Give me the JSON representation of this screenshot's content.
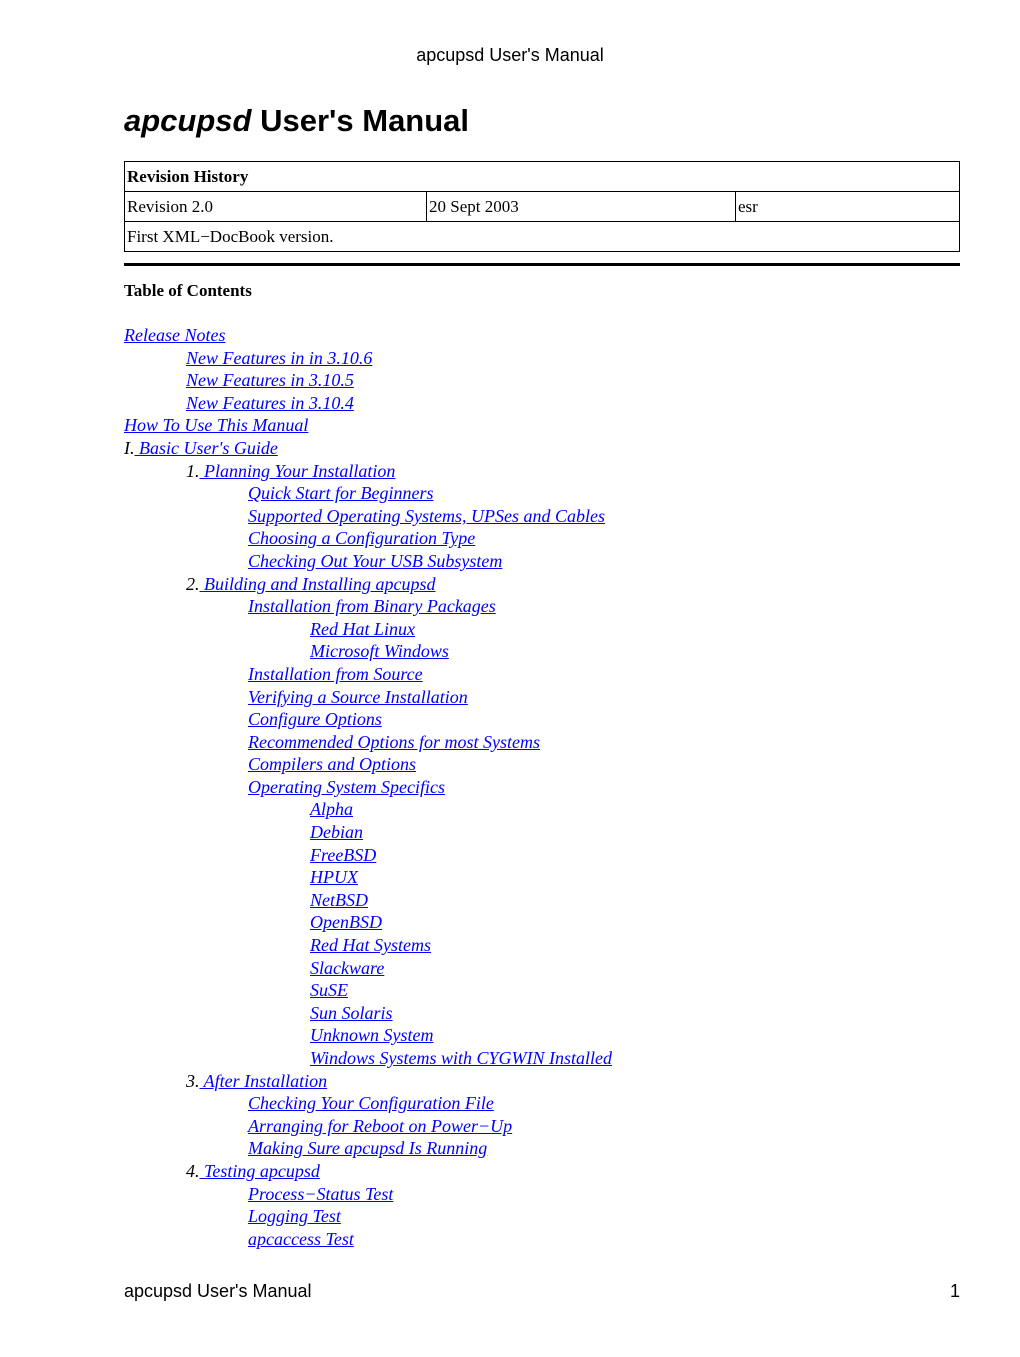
{
  "header": {
    "running_title": "apcupsd User's Manual"
  },
  "title": {
    "program": "apcupsd",
    "rest": " User's Manual"
  },
  "revision_history": {
    "heading": "Revision History",
    "revision": "Revision 2.0",
    "date": "20 Sept 2003",
    "author": "esr",
    "remark": "First XML−DocBook version."
  },
  "toc": {
    "heading": "Table of Contents",
    "entries": [
      {
        "level": 0,
        "prefix": "",
        "label": "Release Notes"
      },
      {
        "level": 1,
        "prefix": "",
        "label": "New Features in in 3.10.6"
      },
      {
        "level": 1,
        "prefix": "",
        "label": "New Features in 3.10.5"
      },
      {
        "level": 1,
        "prefix": "",
        "label": "New Features in 3.10.4"
      },
      {
        "level": 0,
        "prefix": "",
        "label": "How To Use This Manual"
      },
      {
        "level": 0,
        "prefix": "I.",
        "label": " Basic User's Guide"
      },
      {
        "level": 1,
        "prefix": "1.",
        "label": " Planning Your Installation"
      },
      {
        "level": 2,
        "prefix": "",
        "label": "Quick Start for Beginners"
      },
      {
        "level": 2,
        "prefix": "",
        "label": "Supported Operating Systems, UPSes and Cables"
      },
      {
        "level": 2,
        "prefix": "",
        "label": "Choosing a Configuration Type"
      },
      {
        "level": 2,
        "prefix": "",
        "label": "Checking Out Your USB Subsystem"
      },
      {
        "level": 1,
        "prefix": "2.",
        "label": " Building and Installing apcupsd"
      },
      {
        "level": 2,
        "prefix": "",
        "label": "Installation from Binary Packages"
      },
      {
        "level": 3,
        "prefix": "",
        "label": "Red Hat Linux"
      },
      {
        "level": 3,
        "prefix": "",
        "label": "Microsoft Windows"
      },
      {
        "level": 2,
        "prefix": "",
        "label": "Installation from Source"
      },
      {
        "level": 2,
        "prefix": "",
        "label": "Verifying a Source Installation"
      },
      {
        "level": 2,
        "prefix": "",
        "label": "Configure Options"
      },
      {
        "level": 2,
        "prefix": "",
        "label": "Recommended Options for most Systems"
      },
      {
        "level": 2,
        "prefix": "",
        "label": "Compilers and Options"
      },
      {
        "level": 2,
        "prefix": "",
        "label": "Operating System Specifics"
      },
      {
        "level": 3,
        "prefix": "",
        "label": "Alpha"
      },
      {
        "level": 3,
        "prefix": "",
        "label": "Debian"
      },
      {
        "level": 3,
        "prefix": "",
        "label": "FreeBSD"
      },
      {
        "level": 3,
        "prefix": "",
        "label": "HPUX"
      },
      {
        "level": 3,
        "prefix": "",
        "label": "NetBSD"
      },
      {
        "level": 3,
        "prefix": "",
        "label": "OpenBSD"
      },
      {
        "level": 3,
        "prefix": "",
        "label": "Red Hat Systems"
      },
      {
        "level": 3,
        "prefix": "",
        "label": "Slackware"
      },
      {
        "level": 3,
        "prefix": "",
        "label": "SuSE"
      },
      {
        "level": 3,
        "prefix": "",
        "label": "Sun Solaris"
      },
      {
        "level": 3,
        "prefix": "",
        "label": "Unknown System"
      },
      {
        "level": 3,
        "prefix": "",
        "label": "Windows Systems with CYGWIN Installed"
      },
      {
        "level": 1,
        "prefix": "3.",
        "label": " After Installation"
      },
      {
        "level": 2,
        "prefix": "",
        "label": "Checking Your Configuration File"
      },
      {
        "level": 2,
        "prefix": "",
        "label": "Arranging for Reboot on Power−Up"
      },
      {
        "level": 2,
        "prefix": "",
        "label": "Making Sure apcupsd Is Running"
      },
      {
        "level": 1,
        "prefix": "4.",
        "label": " Testing apcupsd"
      },
      {
        "level": 2,
        "prefix": "",
        "label": "Process−Status Test"
      },
      {
        "level": 2,
        "prefix": "",
        "label": "Logging Test"
      },
      {
        "level": 2,
        "prefix": "",
        "label": "apcaccess Test"
      }
    ]
  },
  "footer": {
    "running_title": "apcupsd User's Manual",
    "page_number": "1"
  },
  "colors": {
    "link": "#0000ff",
    "text": "#000000"
  }
}
